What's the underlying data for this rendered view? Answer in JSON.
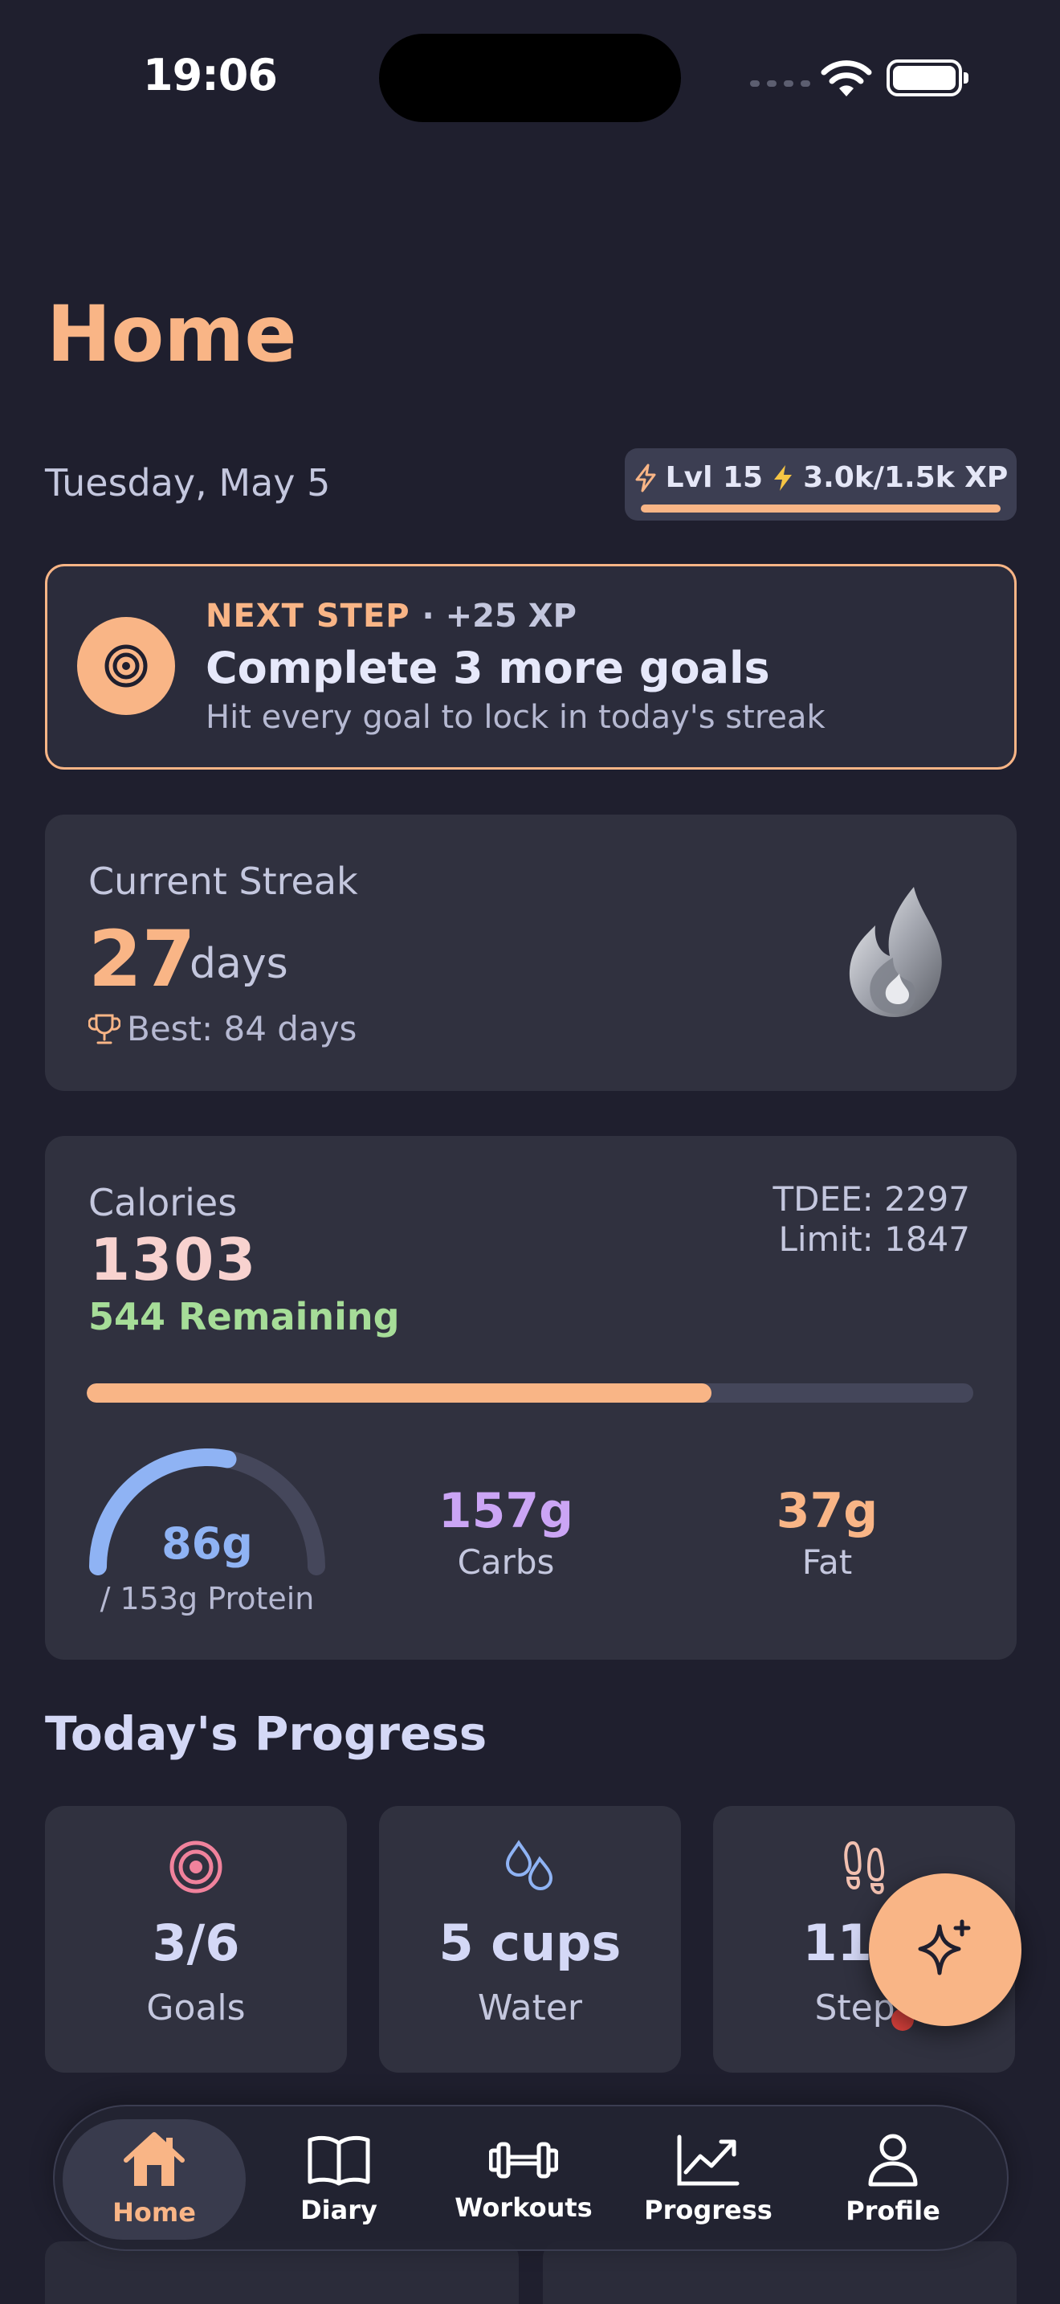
{
  "status_bar": {
    "time": "19:06"
  },
  "header": {
    "title": "Home",
    "date": "Tuesday, May 5"
  },
  "xp": {
    "level": "Lvl 15",
    "xp_text": "3.0k/1.5k XP",
    "progress": 1.0
  },
  "next_step": {
    "kicker": "NEXT STEP",
    "reward": "· +25 XP",
    "title": "Complete 3 more goals",
    "subtitle": "Hit every goal to lock in today's streak"
  },
  "streak": {
    "label": "Current Streak",
    "value": "27",
    "unit": "days",
    "best": "Best: 84 days"
  },
  "calories": {
    "label": "Calories",
    "value": "1303",
    "remaining": "544 Remaining",
    "tdee": "TDEE: 2297",
    "limit": "Limit: 1847",
    "progress": 0.705
  },
  "macros": {
    "protein": {
      "value": "86g",
      "target": "/ 153g Protein",
      "progress": 0.56
    },
    "carbs": {
      "value": "157g",
      "label": "Carbs"
    },
    "fat": {
      "value": "37g",
      "label": "Fat"
    }
  },
  "today": {
    "title": "Today's Progress",
    "tiles": [
      {
        "value": "3/6",
        "label": "Goals"
      },
      {
        "value": "5 cups",
        "label": "Water"
      },
      {
        "value": "11,2",
        "label": "Steps"
      }
    ]
  },
  "colors": {
    "accent": "#f9b586",
    "background": "#1f1f2e",
    "card": "#30313f",
    "protein": "#8fb3f4",
    "carbs": "#cba5f5",
    "remaining": "#a6dd98"
  },
  "tabbar": {
    "items": [
      {
        "label": "Home",
        "icon": "home-icon"
      },
      {
        "label": "Diary",
        "icon": "book-icon"
      },
      {
        "label": "Workouts",
        "icon": "dumbbell-icon"
      },
      {
        "label": "Progress",
        "icon": "chart-icon"
      },
      {
        "label": "Profile",
        "icon": "person-icon"
      }
    ]
  }
}
